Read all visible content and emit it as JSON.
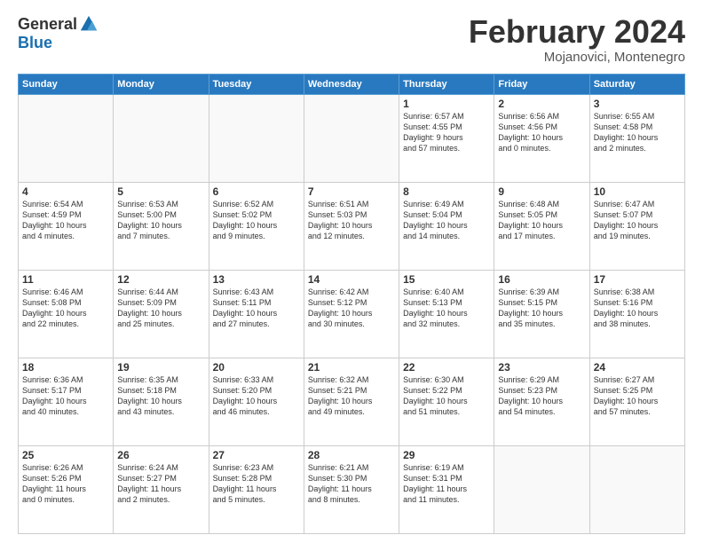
{
  "logo": {
    "general": "General",
    "blue": "Blue",
    "tagline": ""
  },
  "header": {
    "month": "February 2024",
    "location": "Mojanovici, Montenegro"
  },
  "weekdays": [
    "Sunday",
    "Monday",
    "Tuesday",
    "Wednesday",
    "Thursday",
    "Friday",
    "Saturday"
  ],
  "weeks": [
    [
      {
        "day": "",
        "info": ""
      },
      {
        "day": "",
        "info": ""
      },
      {
        "day": "",
        "info": ""
      },
      {
        "day": "",
        "info": ""
      },
      {
        "day": "1",
        "info": "Sunrise: 6:57 AM\nSunset: 4:55 PM\nDaylight: 9 hours\nand 57 minutes."
      },
      {
        "day": "2",
        "info": "Sunrise: 6:56 AM\nSunset: 4:56 PM\nDaylight: 10 hours\nand 0 minutes."
      },
      {
        "day": "3",
        "info": "Sunrise: 6:55 AM\nSunset: 4:58 PM\nDaylight: 10 hours\nand 2 minutes."
      }
    ],
    [
      {
        "day": "4",
        "info": "Sunrise: 6:54 AM\nSunset: 4:59 PM\nDaylight: 10 hours\nand 4 minutes."
      },
      {
        "day": "5",
        "info": "Sunrise: 6:53 AM\nSunset: 5:00 PM\nDaylight: 10 hours\nand 7 minutes."
      },
      {
        "day": "6",
        "info": "Sunrise: 6:52 AM\nSunset: 5:02 PM\nDaylight: 10 hours\nand 9 minutes."
      },
      {
        "day": "7",
        "info": "Sunrise: 6:51 AM\nSunset: 5:03 PM\nDaylight: 10 hours\nand 12 minutes."
      },
      {
        "day": "8",
        "info": "Sunrise: 6:49 AM\nSunset: 5:04 PM\nDaylight: 10 hours\nand 14 minutes."
      },
      {
        "day": "9",
        "info": "Sunrise: 6:48 AM\nSunset: 5:05 PM\nDaylight: 10 hours\nand 17 minutes."
      },
      {
        "day": "10",
        "info": "Sunrise: 6:47 AM\nSunset: 5:07 PM\nDaylight: 10 hours\nand 19 minutes."
      }
    ],
    [
      {
        "day": "11",
        "info": "Sunrise: 6:46 AM\nSunset: 5:08 PM\nDaylight: 10 hours\nand 22 minutes."
      },
      {
        "day": "12",
        "info": "Sunrise: 6:44 AM\nSunset: 5:09 PM\nDaylight: 10 hours\nand 25 minutes."
      },
      {
        "day": "13",
        "info": "Sunrise: 6:43 AM\nSunset: 5:11 PM\nDaylight: 10 hours\nand 27 minutes."
      },
      {
        "day": "14",
        "info": "Sunrise: 6:42 AM\nSunset: 5:12 PM\nDaylight: 10 hours\nand 30 minutes."
      },
      {
        "day": "15",
        "info": "Sunrise: 6:40 AM\nSunset: 5:13 PM\nDaylight: 10 hours\nand 32 minutes."
      },
      {
        "day": "16",
        "info": "Sunrise: 6:39 AM\nSunset: 5:15 PM\nDaylight: 10 hours\nand 35 minutes."
      },
      {
        "day": "17",
        "info": "Sunrise: 6:38 AM\nSunset: 5:16 PM\nDaylight: 10 hours\nand 38 minutes."
      }
    ],
    [
      {
        "day": "18",
        "info": "Sunrise: 6:36 AM\nSunset: 5:17 PM\nDaylight: 10 hours\nand 40 minutes."
      },
      {
        "day": "19",
        "info": "Sunrise: 6:35 AM\nSunset: 5:18 PM\nDaylight: 10 hours\nand 43 minutes."
      },
      {
        "day": "20",
        "info": "Sunrise: 6:33 AM\nSunset: 5:20 PM\nDaylight: 10 hours\nand 46 minutes."
      },
      {
        "day": "21",
        "info": "Sunrise: 6:32 AM\nSunset: 5:21 PM\nDaylight: 10 hours\nand 49 minutes."
      },
      {
        "day": "22",
        "info": "Sunrise: 6:30 AM\nSunset: 5:22 PM\nDaylight: 10 hours\nand 51 minutes."
      },
      {
        "day": "23",
        "info": "Sunrise: 6:29 AM\nSunset: 5:23 PM\nDaylight: 10 hours\nand 54 minutes."
      },
      {
        "day": "24",
        "info": "Sunrise: 6:27 AM\nSunset: 5:25 PM\nDaylight: 10 hours\nand 57 minutes."
      }
    ],
    [
      {
        "day": "25",
        "info": "Sunrise: 6:26 AM\nSunset: 5:26 PM\nDaylight: 11 hours\nand 0 minutes."
      },
      {
        "day": "26",
        "info": "Sunrise: 6:24 AM\nSunset: 5:27 PM\nDaylight: 11 hours\nand 2 minutes."
      },
      {
        "day": "27",
        "info": "Sunrise: 6:23 AM\nSunset: 5:28 PM\nDaylight: 11 hours\nand 5 minutes."
      },
      {
        "day": "28",
        "info": "Sunrise: 6:21 AM\nSunset: 5:30 PM\nDaylight: 11 hours\nand 8 minutes."
      },
      {
        "day": "29",
        "info": "Sunrise: 6:19 AM\nSunset: 5:31 PM\nDaylight: 11 hours\nand 11 minutes."
      },
      {
        "day": "",
        "info": ""
      },
      {
        "day": "",
        "info": ""
      }
    ]
  ]
}
